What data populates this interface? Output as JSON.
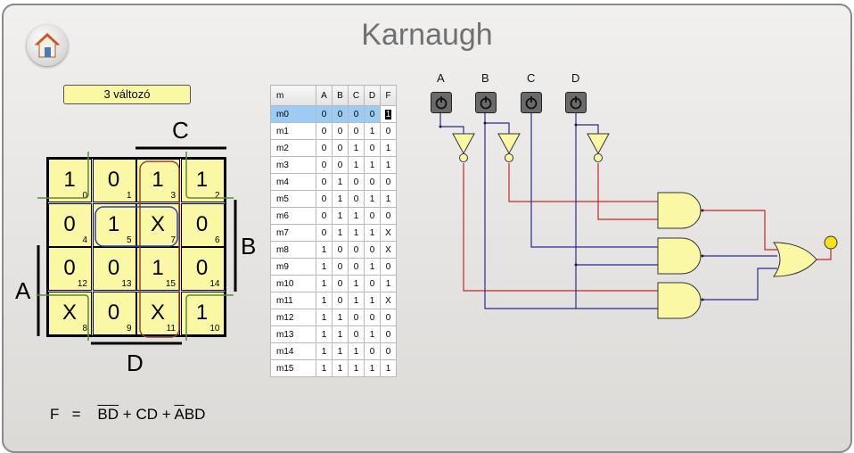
{
  "app": {
    "title": "Karnaugh"
  },
  "home": {
    "icon": "house-icon"
  },
  "variable_button": {
    "label": "3 változó"
  },
  "kmap": {
    "labels": {
      "A": "A",
      "B": "B",
      "C": "C",
      "D": "D"
    },
    "cells": [
      [
        {
          "v": "1",
          "i": "0"
        },
        {
          "v": "0",
          "i": "1"
        },
        {
          "v": "1",
          "i": "3"
        },
        {
          "v": "1",
          "i": "2"
        }
      ],
      [
        {
          "v": "0",
          "i": "4"
        },
        {
          "v": "1",
          "i": "5"
        },
        {
          "v": "X",
          "i": "7"
        },
        {
          "v": "0",
          "i": "6"
        }
      ],
      [
        {
          "v": "0",
          "i": "12"
        },
        {
          "v": "0",
          "i": "13"
        },
        {
          "v": "1",
          "i": "15"
        },
        {
          "v": "0",
          "i": "14"
        }
      ],
      [
        {
          "v": "X",
          "i": "8"
        },
        {
          "v": "0",
          "i": "9"
        },
        {
          "v": "X",
          "i": "11"
        },
        {
          "v": "1",
          "i": "10"
        }
      ]
    ]
  },
  "truth_table": {
    "headers": [
      "m",
      "A",
      "B",
      "C",
      "D",
      "F"
    ],
    "rows": [
      [
        "m0",
        "0",
        "0",
        "0",
        "0",
        "1"
      ],
      [
        "m1",
        "0",
        "0",
        "0",
        "1",
        "0"
      ],
      [
        "m2",
        "0",
        "0",
        "1",
        "0",
        "1"
      ],
      [
        "m3",
        "0",
        "0",
        "1",
        "1",
        "1"
      ],
      [
        "m4",
        "0",
        "1",
        "0",
        "0",
        "0"
      ],
      [
        "m5",
        "0",
        "1",
        "0",
        "1",
        "1"
      ],
      [
        "m6",
        "0",
        "1",
        "1",
        "0",
        "0"
      ],
      [
        "m7",
        "0",
        "1",
        "1",
        "1",
        "X"
      ],
      [
        "m8",
        "1",
        "0",
        "0",
        "0",
        "X"
      ],
      [
        "m9",
        "1",
        "0",
        "0",
        "1",
        "0"
      ],
      [
        "m10",
        "1",
        "0",
        "1",
        "0",
        "1"
      ],
      [
        "m11",
        "1",
        "0",
        "1",
        "1",
        "X"
      ],
      [
        "m12",
        "1",
        "1",
        "0",
        "0",
        "0"
      ],
      [
        "m13",
        "1",
        "1",
        "0",
        "1",
        "0"
      ],
      [
        "m14",
        "1",
        "1",
        "1",
        "0",
        "0"
      ],
      [
        "m15",
        "1",
        "1",
        "1",
        "1",
        "1"
      ]
    ],
    "selected_row": 0
  },
  "formula": {
    "f": "F",
    "eq": "=",
    "t1a": "B",
    "t1b": "D",
    "plus1": "+",
    "t2": "CD",
    "plus2": "+",
    "t3a": "A",
    "t3b": "BD"
  },
  "circuit": {
    "inputs": [
      "A",
      "B",
      "C",
      "D"
    ],
    "colors": {
      "wire_low": "#2b2b8f",
      "wire_high": "#c0282a",
      "gate_fill": "#fbf8a5",
      "output_on": "#f5e21a"
    }
  }
}
